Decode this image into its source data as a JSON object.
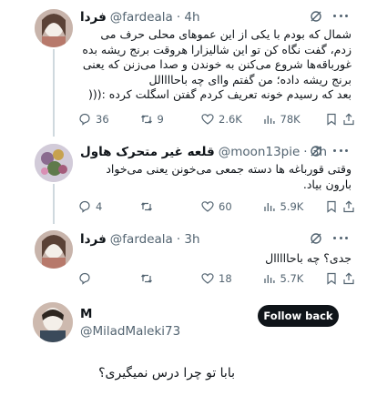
{
  "tweets": [
    {
      "name": "فردا",
      "handle": "@fardeala",
      "time": "· 4h",
      "text": "شمال که بودم با یکی از این عموهای محلی حرف می\nزدم، گفت نگاه کن تو این شالیزارا هروقت برنج ریشه بده\nغورباقه‌ها شروع می‌کنن به خوندن و صدا می‌زنن که یعنی\nبرنج ریشه داده؛ من گفتم واای چه باحاااالل\nبعد که رسیدم خونه تعریف کردم گفتن اسگلت کرده :(((",
      "replies": "36",
      "reposts": "9",
      "likes": "2.6K",
      "views": "78K"
    },
    {
      "name": "قلعه غیر متحرک هاول",
      "handle": "@moon13pie",
      "time": "· 3h",
      "text": "وقتی قورباغه ها دسته جمعی می‌خونن یعنی می‌خواد\nبارون بیاد.",
      "replies": "4",
      "reposts": "",
      "likes": "60",
      "views": "5.9K"
    },
    {
      "name": "فردا",
      "handle": "@fardeala",
      "time": "· 3h",
      "text": "جدی؟ چه باحااااال",
      "replies": "",
      "reposts": "",
      "likes": "18",
      "views": "5.7K"
    }
  ],
  "reply_tweet": {
    "name": "M",
    "handle": "@MiladMaleki73",
    "follow_label": "Follow back",
    "text": "بابا تو چرا درس نمیگیری؟"
  },
  "icons": {
    "reply": "reply-icon",
    "repost": "repost-icon",
    "like": "heart-icon",
    "views": "views-icon",
    "bookmark": "bookmark-icon",
    "share": "share-icon",
    "more": "more-icon"
  }
}
